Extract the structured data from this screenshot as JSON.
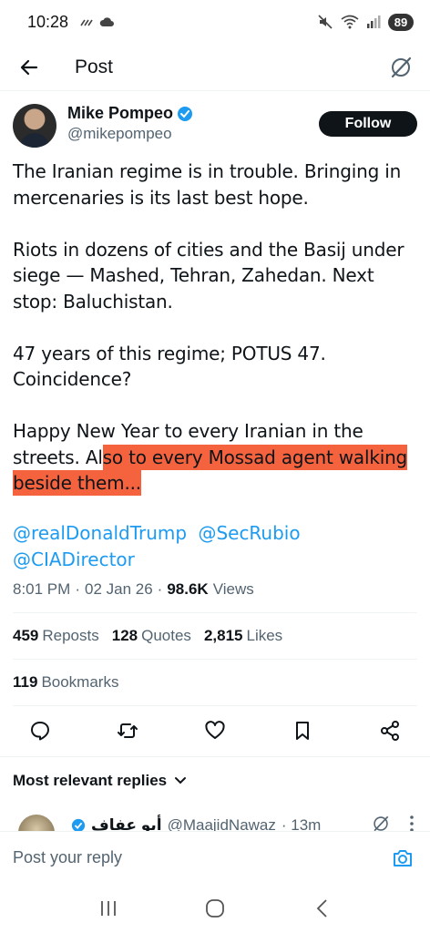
{
  "status_bar": {
    "time": "10:28",
    "battery": "89"
  },
  "header": {
    "title": "Post"
  },
  "post": {
    "author": {
      "display_name": "Mike Pompeo",
      "handle": "@mikepompeo",
      "follow_label": "Follow"
    },
    "paragraphs": [
      "The Iranian regime is in trouble. Bringing in mercenaries is its last best hope.",
      "Riots in dozens of cities and the Basij under siege — Mashed, Tehran, Zahedan.  Next stop:  Baluchistan.",
      "47 years of this regime; POTUS 47. Coincidence?"
    ],
    "last_paragraph_plain": "Happy New Year to every Iranian in the streets.  Al",
    "last_paragraph_highlighted": "so to every Mossad agent walking beside them...",
    "mentions": [
      "@realDonaldTrump",
      "@SecRubio",
      "@CIADirector"
    ],
    "time": "8:01 PM",
    "date": "02 Jan 26",
    "views_count": "98.6K",
    "views_label": "Views",
    "stats": {
      "reposts_count": "459",
      "reposts_label": "Reposts",
      "quotes_count": "128",
      "quotes_label": "Quotes",
      "likes_count": "2,815",
      "likes_label": "Likes",
      "bookmarks_count": "119",
      "bookmarks_label": "Bookmarks"
    }
  },
  "replies": {
    "header_label": "Most relevant replies",
    "preview": {
      "name": "أبو عفاف",
      "handle": "@MaajidNawaz",
      "time": "· 13m"
    }
  },
  "reply_bar": {
    "placeholder": "Post your reply"
  },
  "colors": {
    "accent": "#1d9bf0",
    "highlight": "#f5633e",
    "text": "#0f1419",
    "muted": "#536471"
  }
}
